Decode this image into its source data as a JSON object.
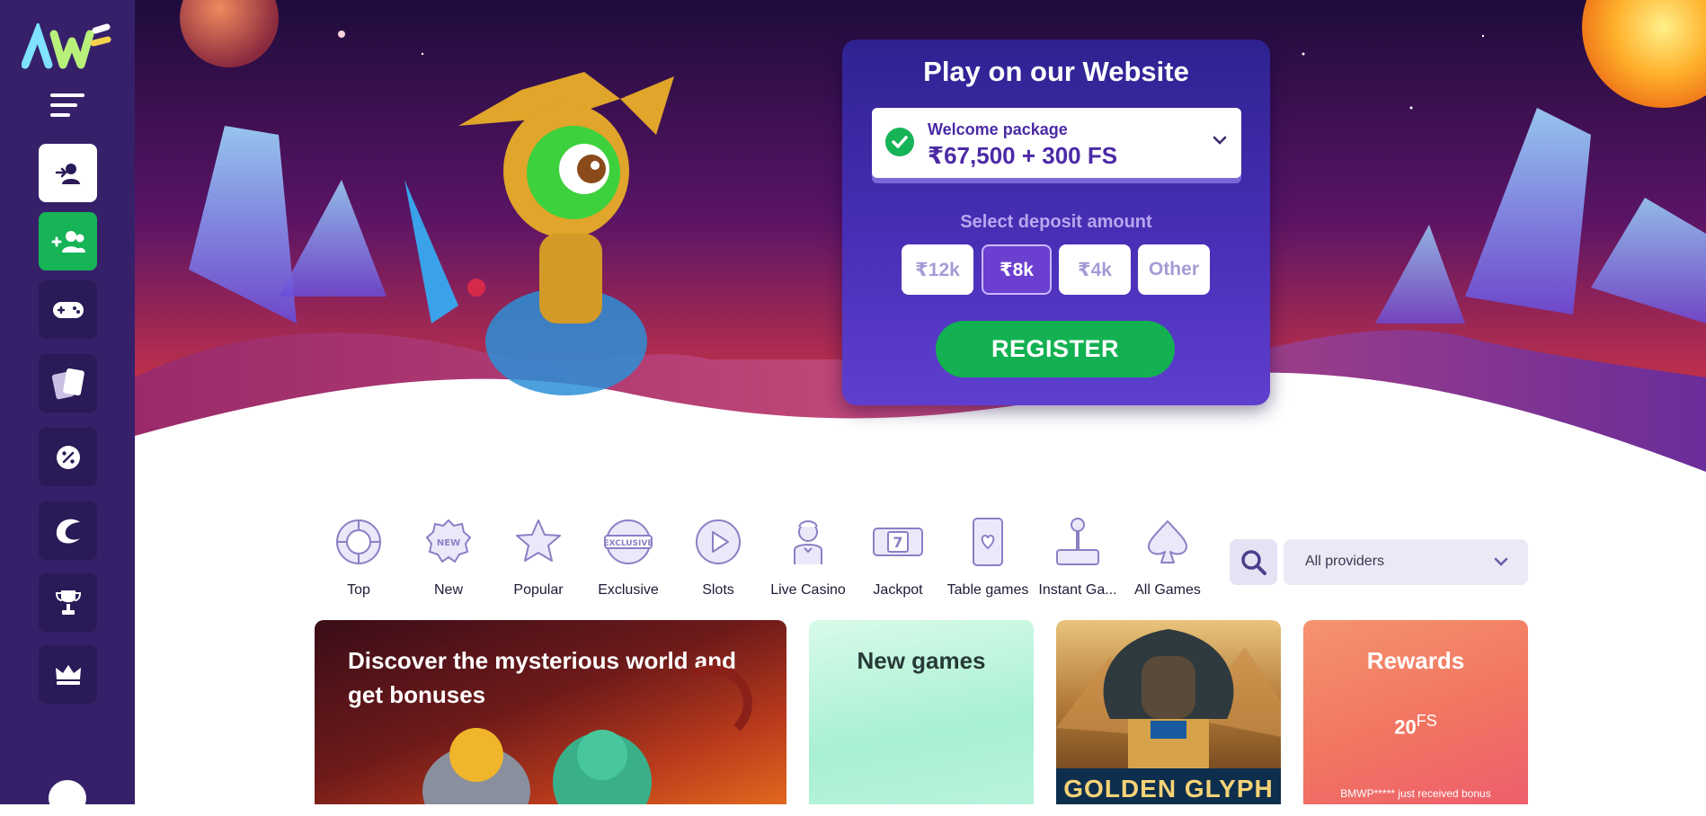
{
  "sidebar": {
    "logo_text": "AW",
    "items": [
      {
        "icon": "login-user-icon",
        "style": "white"
      },
      {
        "icon": "add-users-icon",
        "style": "green"
      },
      {
        "icon": "gamepad-icon",
        "style": "dark"
      },
      {
        "icon": "cards-icon",
        "style": "dark"
      },
      {
        "icon": "promo-badge-icon",
        "style": "dark"
      },
      {
        "icon": "crescent-icon",
        "style": "dark"
      },
      {
        "icon": "trophy-icon",
        "style": "dark"
      },
      {
        "icon": "crown-icon",
        "style": "dark"
      }
    ]
  },
  "signup": {
    "title": "Play on our Website",
    "package_label": "Welcome package",
    "package_value": "₹67,500 + 300 FS",
    "deposit_label": "Select deposit amount",
    "amounts": [
      "₹12k",
      "₹8k",
      "₹4k",
      "Other"
    ],
    "selected_amount": "₹8k",
    "register_label": "REGISTER"
  },
  "categories": [
    {
      "label": "Top",
      "icon": "top-icon"
    },
    {
      "label": "New",
      "icon": "new-icon"
    },
    {
      "label": "Popular",
      "icon": "star-icon"
    },
    {
      "label": "Exclusive",
      "icon": "exclusive-icon"
    },
    {
      "label": "Slots",
      "icon": "slots-icon"
    },
    {
      "label": "Live Casino",
      "icon": "live-dealer-icon"
    },
    {
      "label": "Jackpot",
      "icon": "jackpot-icon"
    },
    {
      "label": "Table games",
      "icon": "table-games-icon"
    },
    {
      "label": "Instant Ga...",
      "icon": "joystick-icon"
    },
    {
      "label": "All Games",
      "icon": "spade-icon"
    }
  ],
  "providers": {
    "label": "All providers"
  },
  "promo": {
    "tile1_title": "Discover the mysterious world and get bonuses",
    "tile2_title": "New games",
    "tile3_logo": "GOLDEN GLYPH",
    "tile4_title": "Rewards",
    "tile4_fs_number": "20",
    "tile4_fs_unit": "FS",
    "tile4_note": "BMWP***** just received bonus"
  },
  "colors": {
    "sidebar": "#36206a",
    "accent_green": "#16b357",
    "accent_purple": "#6b3fd0"
  }
}
